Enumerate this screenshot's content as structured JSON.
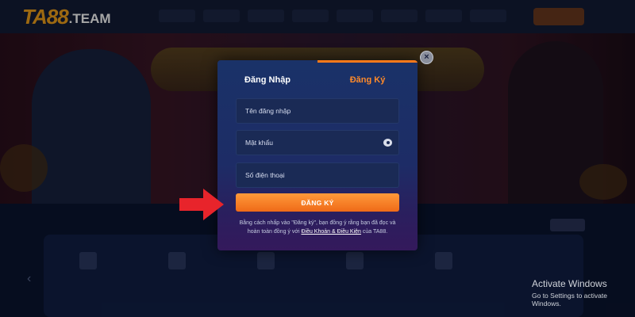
{
  "brand": {
    "logo_main": "TA88",
    "logo_suffix": ".TEAM"
  },
  "modal": {
    "tabs": [
      {
        "label": "Đăng Nhập",
        "active": false
      },
      {
        "label": "Đăng Ký",
        "active": true
      }
    ],
    "fields": {
      "username_placeholder": "Tên đăng nhập",
      "password_placeholder": "Mật khẩu",
      "phone_placeholder": "Số điện thoại"
    },
    "submit_label": "ĐĂNG KÝ",
    "terms": {
      "prefix": "Bằng cách nhấp vào \"Đăng ký\", bạn đồng ý rằng bạn đã đọc và hoàn toàn đồng ý với ",
      "link": "Điều Khoản & Điều Kiện",
      "suffix": " của TA88."
    },
    "close_icon": "×"
  },
  "watermark": {
    "title": "Activate Windows",
    "subtitle": "Go to Settings to activate Windows."
  },
  "colors": {
    "accent": "#ff7a1a",
    "brand_gold": "#f2a21b",
    "arrow": "#e8242b"
  },
  "icons": [
    "eye-icon",
    "close-icon",
    "red-arrow-icon"
  ]
}
